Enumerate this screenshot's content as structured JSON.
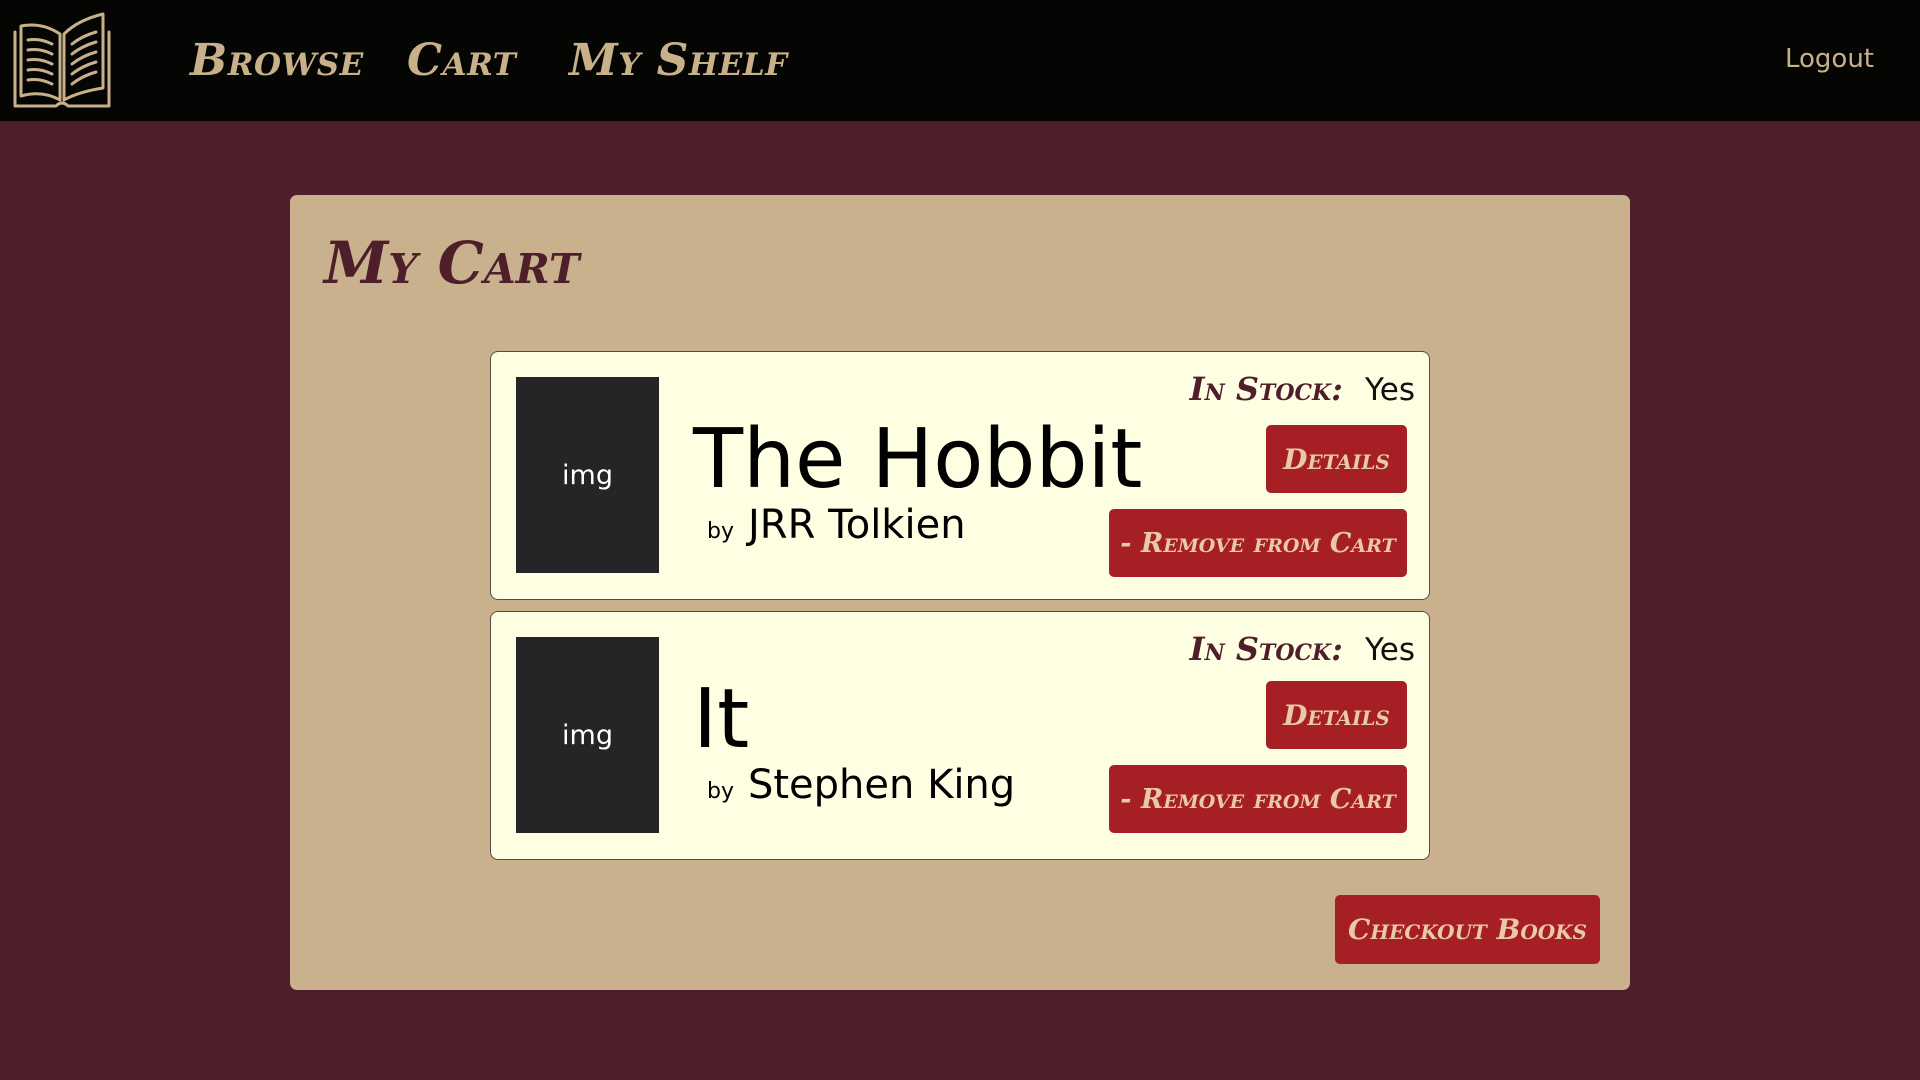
{
  "nav": {
    "logo_icon": "open-book-icon",
    "browse": "Browse",
    "cart": "Cart",
    "shelf": "My Shelf",
    "logout": "Logout"
  },
  "page": {
    "title": "My Cart"
  },
  "cart": {
    "items": [
      {
        "cover": "img",
        "title": "The Hobbit",
        "by": "by",
        "author": "JRR Tolkien",
        "stock_label": "In Stock:",
        "stock_value": "Yes",
        "details": "Details",
        "remove": "- Remove from Cart"
      },
      {
        "cover": "img",
        "title": "It",
        "by": "by",
        "author": "Stephen King",
        "stock_label": "In Stock:",
        "stock_value": "Yes",
        "details": "Details",
        "remove": "- Remove from Cart"
      }
    ],
    "checkout": "Checkout Books"
  },
  "colors": {
    "background": "#4e1e2a",
    "navbar": "#050504",
    "nav_text": "#c8b18a",
    "panel": "#c8b18c",
    "card": "#fefee3",
    "button": "#a51f24",
    "button_text": "#e8c9a8",
    "accent_text": "#4e1e2a"
  }
}
